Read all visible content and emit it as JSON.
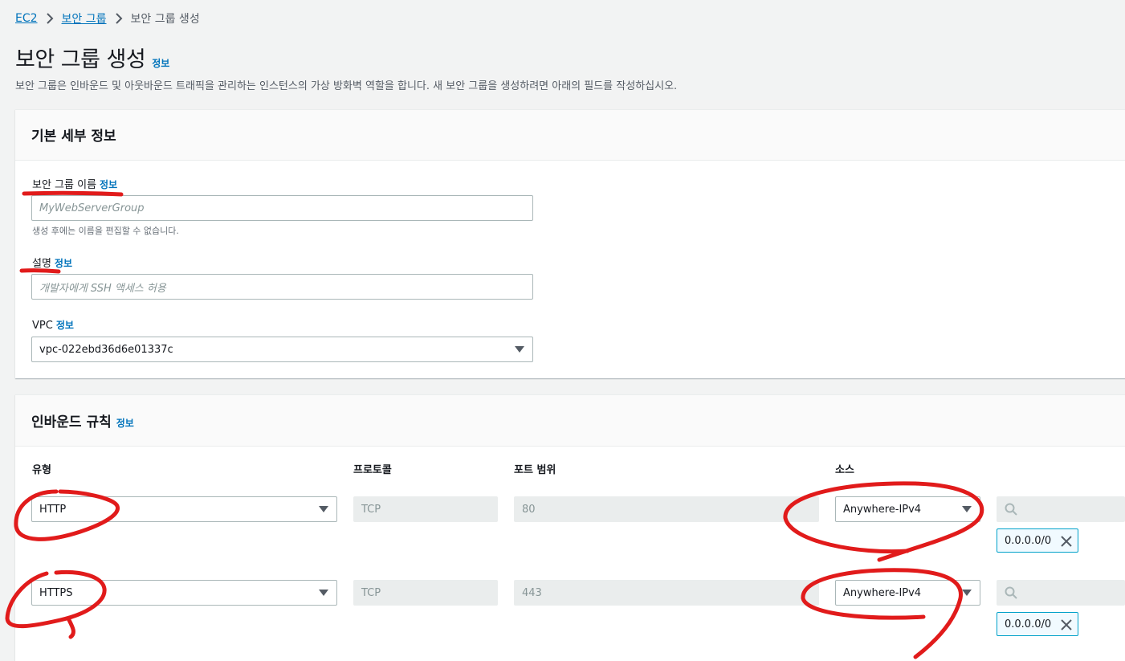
{
  "breadcrumb": {
    "root": "EC2",
    "parent": "보안 그룹",
    "current": "보안 그룹 생성"
  },
  "header": {
    "title": "보안 그룹 생성",
    "info": "정보",
    "description": "보안 그룹은 인바운드 및 아웃바운드 트래픽을 관리하는 인스턴스의 가상 방화벽 역할을 합니다. 새 보안 그룹을 생성하려면 아래의 필드를 작성하십시오."
  },
  "basic": {
    "title": "기본 세부 정보",
    "name_label": "보안 그룹 이름",
    "name_info": "정보",
    "name_placeholder": "MyWebServerGroup",
    "name_hint": "생성 후에는 이름을 편집할 수 없습니다.",
    "desc_label": "설명",
    "desc_info": "정보",
    "desc_placeholder": "개발자에게 SSH 액세스 허용",
    "vpc_label": "VPC",
    "vpc_info": "정보",
    "vpc_value": "vpc-022ebd36d6e01337c"
  },
  "inbound": {
    "title": "인바운드 규칙",
    "info": "정보",
    "columns": {
      "type": "유형",
      "protocol": "프로토콜",
      "port": "포트 범위",
      "source": "소스"
    },
    "rules": [
      {
        "type": "HTTP",
        "protocol": "TCP",
        "port": "80",
        "source": "Anywhere-IPv4",
        "cidr": "0.0.0.0/0"
      },
      {
        "type": "HTTPS",
        "protocol": "TCP",
        "port": "443",
        "source": "Anywhere-IPv4",
        "cidr": "0.0.0.0/0"
      }
    ]
  },
  "icons": {
    "separator": "chevron-right-icon",
    "search": "search-icon",
    "remove": "close-icon",
    "dropdown": "caret-down-icon"
  },
  "colors": {
    "link": "#0073bb",
    "annotation": "#e11b1b",
    "token_border": "#00a1c9"
  }
}
